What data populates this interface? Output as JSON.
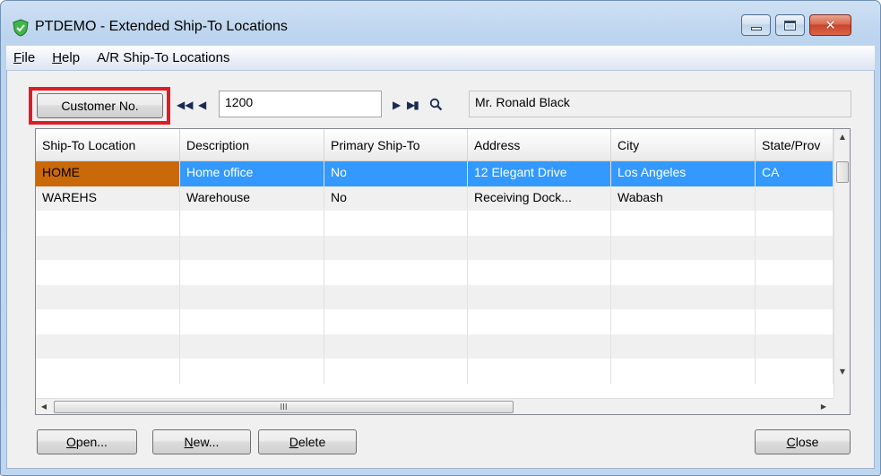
{
  "window": {
    "title": "PTDEMO - Extended Ship-To Locations"
  },
  "menu": [
    {
      "label": "File",
      "accel": "F"
    },
    {
      "label": "Help",
      "accel": "H"
    },
    {
      "label": "A/R Ship-To Locations",
      "accel": ""
    }
  ],
  "finder": {
    "customer_button_label": "Customer No.",
    "customer_number": "1200",
    "customer_name": "Mr. Ronald Black"
  },
  "grid": {
    "columns": [
      "Ship-To Location",
      "Description",
      "Primary Ship-To",
      "Address",
      "City",
      "State/Prov"
    ],
    "rows": [
      [
        "HOME",
        "Home office",
        "No",
        "12 Elegant Drive",
        "Los Angeles",
        "CA"
      ],
      [
        "WAREHS",
        "Warehouse",
        "No",
        "Receiving Dock...",
        "Wabash",
        ""
      ]
    ],
    "selected_row": 0,
    "hscroll_thumb_glyph": "III"
  },
  "buttons": {
    "open": {
      "rest": "pen...",
      "accel": "O"
    },
    "new": {
      "rest": "ew...",
      "accel": "N"
    },
    "delete": {
      "rest": "elete",
      "accel": "D"
    },
    "close": {
      "rest": "lose",
      "accel": "C"
    }
  },
  "colors": {
    "selection": "#3399ff",
    "selected_key_cell": "#c9690a",
    "highlight_box": "#e11b24"
  }
}
